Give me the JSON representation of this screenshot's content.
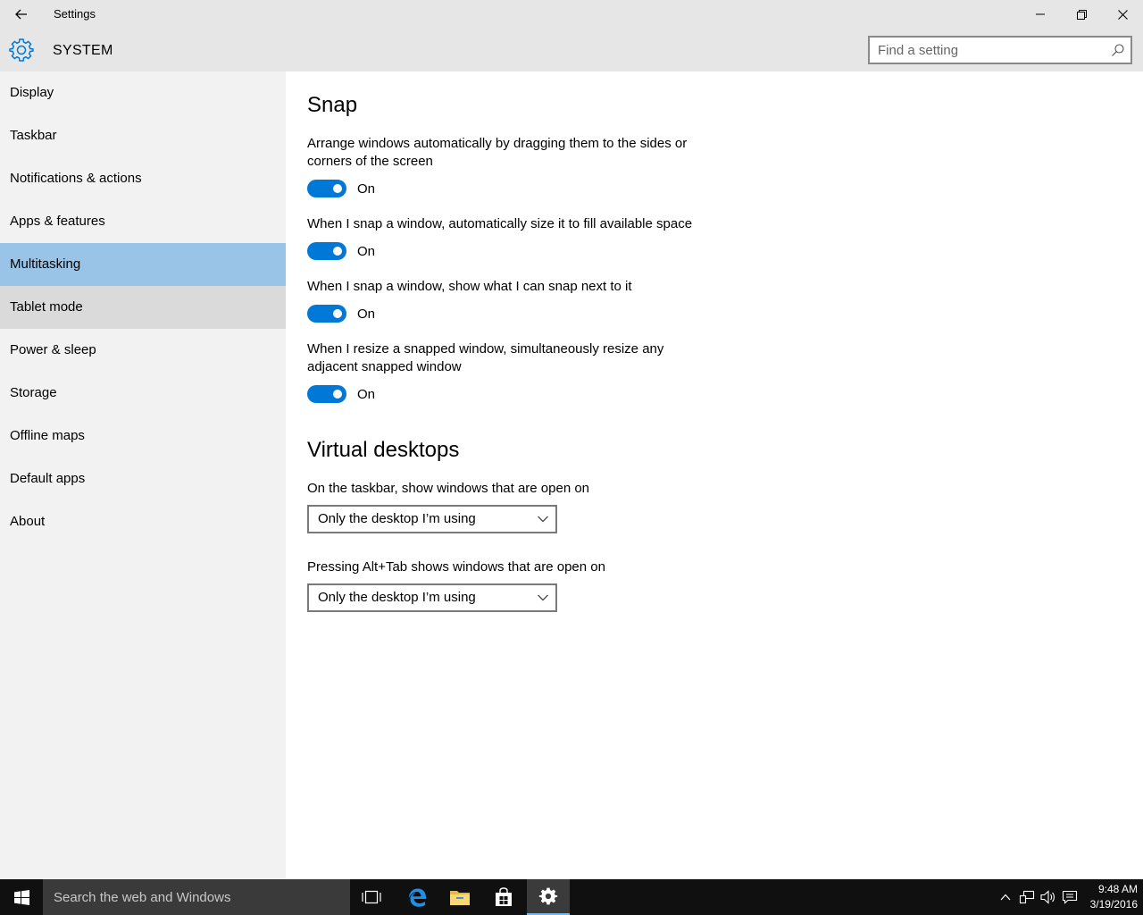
{
  "window": {
    "title": "Settings"
  },
  "header": {
    "title": "SYSTEM",
    "search_placeholder": "Find a setting"
  },
  "sidebar": {
    "items": [
      {
        "label": "Display"
      },
      {
        "label": "Taskbar"
      },
      {
        "label": "Notifications & actions"
      },
      {
        "label": "Apps & features"
      },
      {
        "label": "Multitasking",
        "selected": true
      },
      {
        "label": "Tablet mode"
      },
      {
        "label": "Power & sleep"
      },
      {
        "label": "Storage"
      },
      {
        "label": "Offline maps"
      },
      {
        "label": "Default apps"
      },
      {
        "label": "About"
      }
    ]
  },
  "snap": {
    "title": "Snap",
    "settings": [
      {
        "description": "Arrange windows automatically by dragging them to the sides or corners of the screen",
        "state": "On"
      },
      {
        "description": "When I snap a window, automatically size it to fill available space",
        "state": "On"
      },
      {
        "description": "When I snap a window, show what I can snap next to it",
        "state": "On"
      },
      {
        "description": "When I resize a snapped window, simultaneously resize any adjacent snapped window",
        "state": "On"
      }
    ]
  },
  "virtual_desktops": {
    "title": "Virtual desktops",
    "taskbar_label": "On the taskbar, show windows that are open on",
    "taskbar_value": "Only the desktop I’m using",
    "alttab_label": "Pressing Alt+Tab shows windows that are open on",
    "alttab_value": "Only the desktop I’m using"
  },
  "taskbar": {
    "search_placeholder": "Search the web and Windows",
    "time": "9:48 AM",
    "date": "3/19/2016"
  },
  "colors": {
    "accent": "#0078d7",
    "selected_nav": "#99c4e8",
    "hover_nav": "#dadada"
  }
}
